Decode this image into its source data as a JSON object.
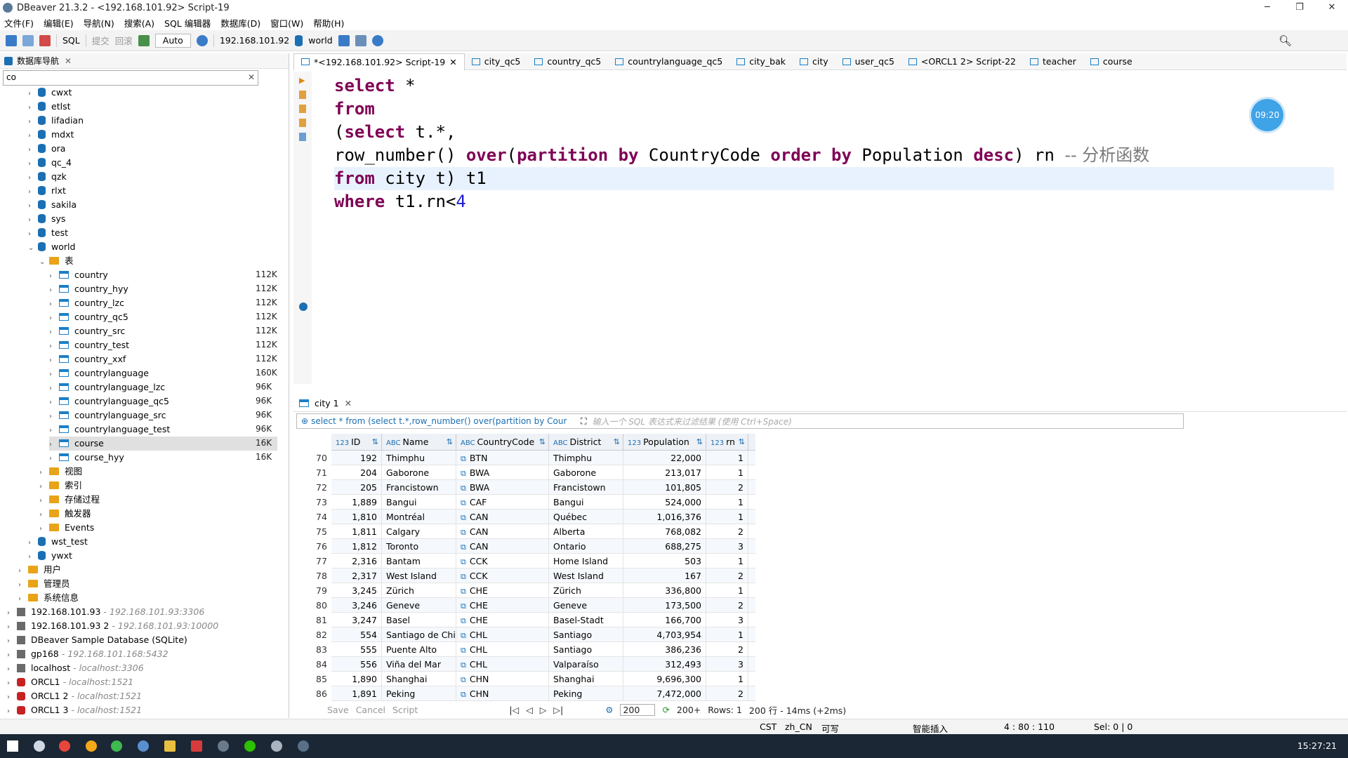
{
  "window": {
    "title": "DBeaver 21.3.2 - <192.168.101.92> Script-19"
  },
  "menu": [
    "文件(F)",
    "编辑(E)",
    "导航(N)",
    "搜索(A)",
    "SQL 编辑器",
    "数据库(D)",
    "窗口(W)",
    "帮助(H)"
  ],
  "toolbar": {
    "sql": "SQL",
    "commit": "提交",
    "rollback": "回滚",
    "mode": "Auto",
    "connection": "192.168.101.92",
    "schema": "world"
  },
  "navigator": {
    "title": "数据库导航",
    "filter": "co",
    "items": [
      {
        "label": "cwxt",
        "type": "db",
        "depth": 2
      },
      {
        "label": "etlst",
        "type": "db",
        "depth": 2
      },
      {
        "label": "lifadian",
        "type": "db",
        "depth": 2
      },
      {
        "label": "mdxt",
        "type": "db",
        "depth": 2
      },
      {
        "label": "ora",
        "type": "db",
        "depth": 2
      },
      {
        "label": "qc_4",
        "type": "db",
        "depth": 2
      },
      {
        "label": "qzk",
        "type": "db",
        "depth": 2
      },
      {
        "label": "rlxt",
        "type": "db",
        "depth": 2
      },
      {
        "label": "sakila",
        "type": "db",
        "depth": 2
      },
      {
        "label": "sys",
        "type": "db",
        "depth": 2
      },
      {
        "label": "test",
        "type": "db",
        "depth": 2
      },
      {
        "label": "world",
        "type": "db",
        "depth": 2,
        "open": true
      },
      {
        "label": "表",
        "type": "folder",
        "depth": 3,
        "open": true
      },
      {
        "label": "country",
        "type": "table",
        "depth": 4,
        "size": "112K"
      },
      {
        "label": "country_hyy",
        "type": "table",
        "depth": 4,
        "size": "112K"
      },
      {
        "label": "country_lzc",
        "type": "table",
        "depth": 4,
        "size": "112K"
      },
      {
        "label": "country_qc5",
        "type": "table",
        "depth": 4,
        "size": "112K"
      },
      {
        "label": "country_src",
        "type": "table",
        "depth": 4,
        "size": "112K"
      },
      {
        "label": "country_test",
        "type": "table",
        "depth": 4,
        "size": "112K"
      },
      {
        "label": "country_xxf",
        "type": "table",
        "depth": 4,
        "size": "112K"
      },
      {
        "label": "countrylanguage",
        "type": "table",
        "depth": 4,
        "size": "160K"
      },
      {
        "label": "countrylanguage_lzc",
        "type": "table",
        "depth": 4,
        "size": "96K"
      },
      {
        "label": "countrylanguage_qc5",
        "type": "table",
        "depth": 4,
        "size": "96K"
      },
      {
        "label": "countrylanguage_src",
        "type": "table",
        "depth": 4,
        "size": "96K"
      },
      {
        "label": "countrylanguage_test",
        "type": "table",
        "depth": 4,
        "size": "96K"
      },
      {
        "label": "course",
        "type": "table",
        "depth": 4,
        "size": "16K",
        "selected": true
      },
      {
        "label": "course_hyy",
        "type": "table",
        "depth": 4,
        "size": "16K"
      },
      {
        "label": "视图",
        "type": "folder",
        "depth": 3
      },
      {
        "label": "索引",
        "type": "folder",
        "depth": 3
      },
      {
        "label": "存储过程",
        "type": "folder",
        "depth": 3
      },
      {
        "label": "触发器",
        "type": "folder",
        "depth": 3
      },
      {
        "label": "Events",
        "type": "folder",
        "depth": 3
      },
      {
        "label": "wst_test",
        "type": "db",
        "depth": 2
      },
      {
        "label": "ywxt",
        "type": "db",
        "depth": 2
      },
      {
        "label": "用户",
        "type": "folder",
        "depth": 1
      },
      {
        "label": "管理员",
        "type": "folder",
        "depth": 1
      },
      {
        "label": "系统信息",
        "type": "folder",
        "depth": 1
      },
      {
        "label": "192.168.101.93",
        "type": "host",
        "depth": 0,
        "sub": " - 192.168.101.93:3306"
      },
      {
        "label": "192.168.101.93 2",
        "type": "host",
        "depth": 0,
        "sub": " - 192.168.101.93:10000"
      },
      {
        "label": "DBeaver Sample Database (SQLite)",
        "type": "host",
        "depth": 0
      },
      {
        "label": "gp168",
        "type": "host",
        "depth": 0,
        "sub": " - 192.168.101.168:5432"
      },
      {
        "label": "localhost",
        "type": "host",
        "depth": 0,
        "sub": " - localhost:3306"
      },
      {
        "label": "ORCL1",
        "type": "oracle",
        "depth": 0,
        "sub": " - localhost:1521"
      },
      {
        "label": "ORCL1 2",
        "type": "oracle",
        "depth": 0,
        "sub": " - localhost:1521"
      },
      {
        "label": "ORCL1 3",
        "type": "oracle",
        "depth": 0,
        "sub": " - localhost:1521"
      }
    ]
  },
  "editor": {
    "tabs": [
      "*<192.168.101.92> Script-19",
      "city_qc5",
      "country_qc5",
      "countrylanguage_qc5",
      "city_bak",
      "city",
      "user_qc5",
      "<ORCL1 2> Script-22",
      "teacher",
      "course"
    ],
    "timer": "09:20",
    "code": [
      {
        "k1": "select",
        "t1": " *"
      },
      {
        "k1": "from"
      },
      {
        "t0": "(",
        "k1": "select",
        "t1": " t.*,"
      },
      {
        "t0": "row_number() ",
        "k1": "over",
        "t1": "(",
        "k2": "partition by",
        "t2": " CountryCode ",
        "k3": "order by",
        "t3": " Population ",
        "k4": "desc",
        "t4": ") rn ",
        "cm": "-- 分析函数"
      },
      {
        "k1": "from",
        "t1": " city t) t1"
      },
      {
        "k1": "where",
        "t1": " t1.rn<",
        "num": "4"
      }
    ]
  },
  "results": {
    "tab": "city 1",
    "query": "select * from (select t.*,row_number() over(partition by Cour",
    "filter_placeholder": "输入一个 SQL 表达式来过滤结果 (使用 Ctrl+Space)",
    "columns": [
      "ID",
      "Name",
      "CountryCode",
      "District",
      "Population",
      "rn"
    ],
    "rows": [
      {
        "n": "70",
        "id": "192",
        "name": "Thimphu",
        "cc": "BTN",
        "district": "Thimphu",
        "pop": "22,000",
        "rn": "1"
      },
      {
        "n": "71",
        "id": "204",
        "name": "Gaborone",
        "cc": "BWA",
        "district": "Gaborone",
        "pop": "213,017",
        "rn": "1"
      },
      {
        "n": "72",
        "id": "205",
        "name": "Francistown",
        "cc": "BWA",
        "district": "Francistown",
        "pop": "101,805",
        "rn": "2"
      },
      {
        "n": "73",
        "id": "1,889",
        "name": "Bangui",
        "cc": "CAF",
        "district": "Bangui",
        "pop": "524,000",
        "rn": "1"
      },
      {
        "n": "74",
        "id": "1,810",
        "name": "Montréal",
        "cc": "CAN",
        "district": "Québec",
        "pop": "1,016,376",
        "rn": "1"
      },
      {
        "n": "75",
        "id": "1,811",
        "name": "Calgary",
        "cc": "CAN",
        "district": "Alberta",
        "pop": "768,082",
        "rn": "2"
      },
      {
        "n": "76",
        "id": "1,812",
        "name": "Toronto",
        "cc": "CAN",
        "district": "Ontario",
        "pop": "688,275",
        "rn": "3"
      },
      {
        "n": "77",
        "id": "2,316",
        "name": "Bantam",
        "cc": "CCK",
        "district": "Home Island",
        "pop": "503",
        "rn": "1"
      },
      {
        "n": "78",
        "id": "2,317",
        "name": "West Island",
        "cc": "CCK",
        "district": "West Island",
        "pop": "167",
        "rn": "2"
      },
      {
        "n": "79",
        "id": "3,245",
        "name": "Zürich",
        "cc": "CHE",
        "district": "Zürich",
        "pop": "336,800",
        "rn": "1"
      },
      {
        "n": "80",
        "id": "3,246",
        "name": "Geneve",
        "cc": "CHE",
        "district": "Geneve",
        "pop": "173,500",
        "rn": "2"
      },
      {
        "n": "81",
        "id": "3,247",
        "name": "Basel",
        "cc": "CHE",
        "district": "Basel-Stadt",
        "pop": "166,700",
        "rn": "3"
      },
      {
        "n": "82",
        "id": "554",
        "name": "Santiago de Chile",
        "cc": "CHL",
        "district": "Santiago",
        "pop": "4,703,954",
        "rn": "1"
      },
      {
        "n": "83",
        "id": "555",
        "name": "Puente Alto",
        "cc": "CHL",
        "district": "Santiago",
        "pop": "386,236",
        "rn": "2"
      },
      {
        "n": "84",
        "id": "556",
        "name": "Viña del Mar",
        "cc": "CHL",
        "district": "Valparaíso",
        "pop": "312,493",
        "rn": "3"
      },
      {
        "n": "85",
        "id": "1,890",
        "name": "Shanghai",
        "cc": "CHN",
        "district": "Shanghai",
        "pop": "9,696,300",
        "rn": "1"
      },
      {
        "n": "86",
        "id": "1,891",
        "name": "Peking",
        "cc": "CHN",
        "district": "Peking",
        "pop": "7,472,000",
        "rn": "2"
      }
    ],
    "bottom": {
      "save": "Save",
      "cancel": "Cancel",
      "script": "Script",
      "fetch_size": "200",
      "fetched": "200+",
      "rows_label": "Rows: 1",
      "summary": "200 行 - 14ms (+2ms)"
    }
  },
  "status": {
    "tz": "CST",
    "locale": "zh_CN",
    "write": "可写",
    "insert": "智能插入",
    "pos": "4 : 80 : 110",
    "sel": "Sel: 0 | 0"
  },
  "taskbar": {
    "time": "15:27:21"
  }
}
